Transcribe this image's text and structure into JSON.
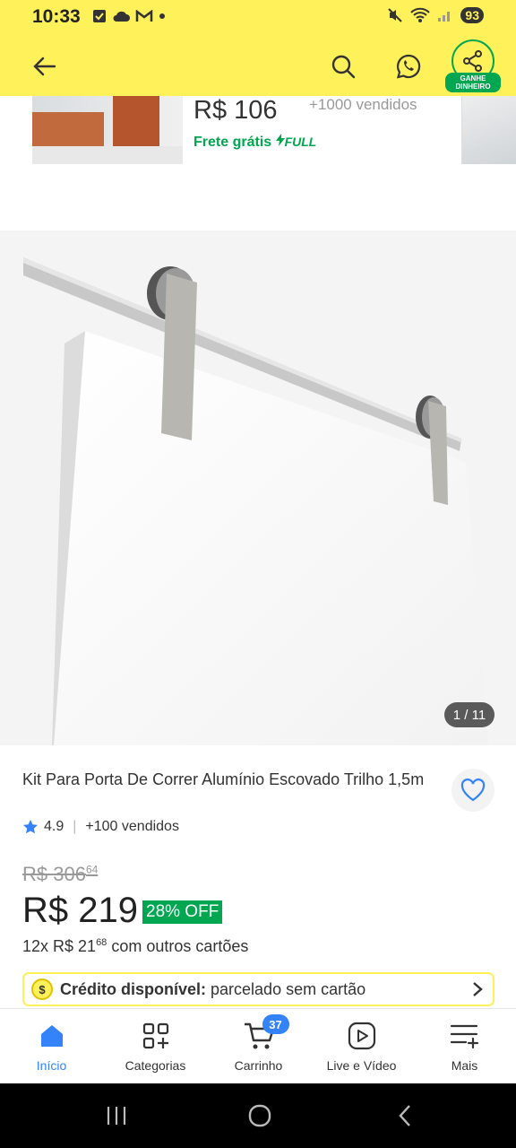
{
  "status_bar": {
    "time": "10:33",
    "battery": "93"
  },
  "header": {
    "earn_badge_line1": "GANHE",
    "earn_badge_line2": "DINHEIRO"
  },
  "prev_card": {
    "price": "R$ 106",
    "sold": "+1000 vendidos",
    "shipping": "Frete grátis",
    "full_label": "FULL"
  },
  "gallery": {
    "counter": "1 / 11"
  },
  "product": {
    "title": "Kit Para Porta De Correr Alumínio Escovado Trilho 1,5m",
    "rating": "4.9",
    "sold": "+100 vendidos",
    "old_price_main": "R$ 306",
    "old_price_cents": "64",
    "price": "R$ 219",
    "discount": "28% OFF",
    "installments_prefix": "12x R$ 21",
    "installments_cents": "68",
    "installments_suffix": " com outros cartões",
    "credit_bold": "Crédito disponível:",
    "credit_text": "parcelado sem cartão"
  },
  "bottom_nav": {
    "items": [
      {
        "label": "Início"
      },
      {
        "label": "Categorias"
      },
      {
        "label": "Carrinho",
        "badge": "37"
      },
      {
        "label": "Live e Vídeo"
      },
      {
        "label": "Mais"
      }
    ]
  },
  "colors": {
    "brand_yellow": "#fff159",
    "green": "#00a650",
    "blue": "#3483fa"
  }
}
